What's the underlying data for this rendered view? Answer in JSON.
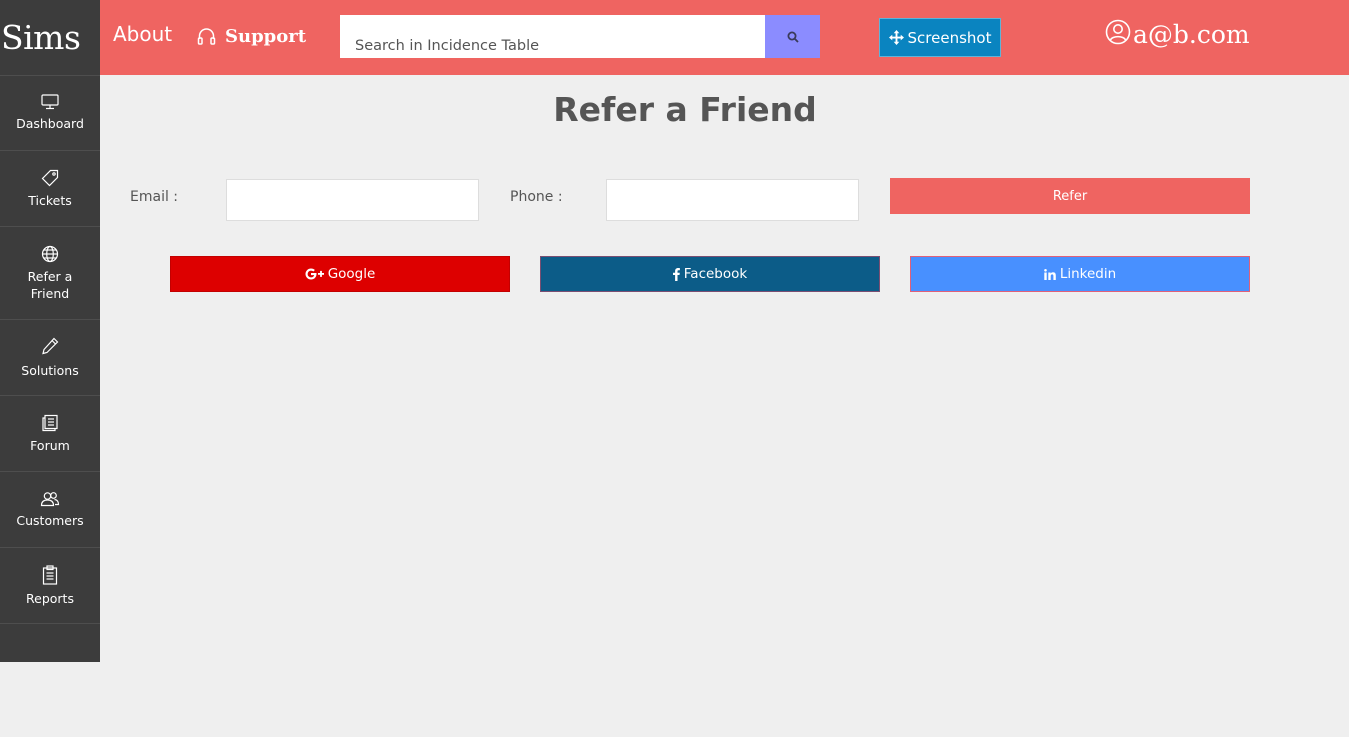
{
  "sidebar": {
    "logo": "Sims",
    "items": [
      {
        "label": "Dashboard",
        "icon": "monitor-icon"
      },
      {
        "label": "Tickets",
        "icon": "tag-icon"
      },
      {
        "label": "Refer a Friend",
        "icon": "globe-icon"
      },
      {
        "label": "Solutions",
        "icon": "pencil-icon"
      },
      {
        "label": "Forum",
        "icon": "forum-icon"
      },
      {
        "label": "Customers",
        "icon": "users-icon"
      },
      {
        "label": "Reports",
        "icon": "clipboard-icon"
      }
    ]
  },
  "header": {
    "about": "About",
    "support": "Support",
    "search_placeholder": "Search in Incidence Table",
    "screenshot": "Screenshot",
    "user": "a@b.com"
  },
  "main": {
    "title": "Refer a Friend",
    "email_label": "Email :",
    "phone_label": "Phone :",
    "email_value": "",
    "phone_value": "",
    "refer_label": "Refer",
    "social": {
      "google": "Google",
      "facebook": "Facebook",
      "linkedin": "Linkedin"
    }
  },
  "colors": {
    "header": "#ef6461",
    "sidebar": "#3c3c3c",
    "search_button": "#8b8cff",
    "screenshot_button": "#0a84c0",
    "google": "#dd0000",
    "facebook": "#0c5c88",
    "linkedin": "#4890ff"
  }
}
